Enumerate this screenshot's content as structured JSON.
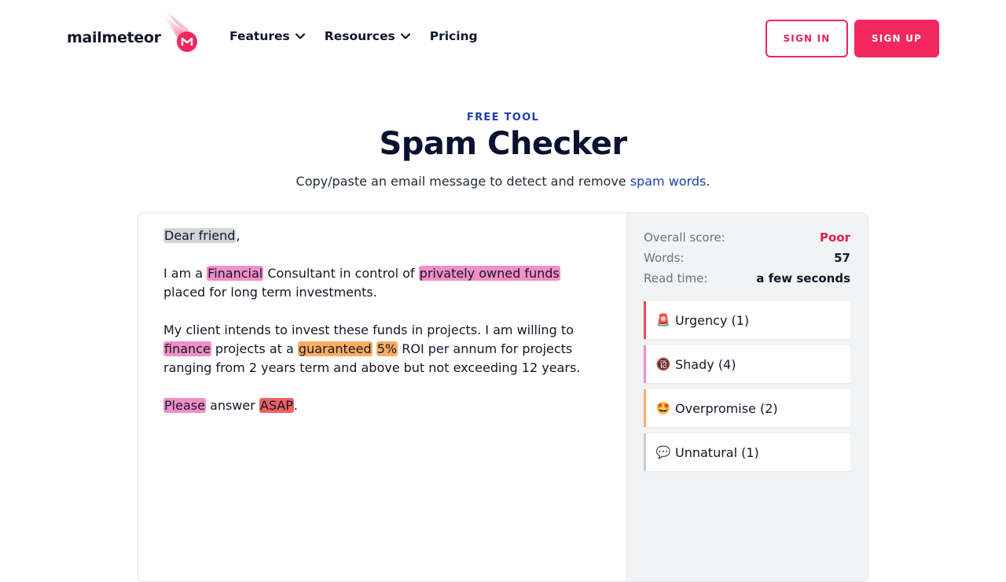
{
  "brand": {
    "name": "mailmeteor",
    "accent": "#f4265f"
  },
  "nav": {
    "items": [
      {
        "label": "Features",
        "dropdown": true
      },
      {
        "label": "Resources",
        "dropdown": true
      },
      {
        "label": "Pricing",
        "dropdown": false
      }
    ],
    "sign_in": "SIGN IN",
    "sign_up": "SIGN UP"
  },
  "hero": {
    "eyebrow": "FREE TOOL",
    "title": "Spam Checker",
    "subtitle_prefix": "Copy/paste an email message to detect and remove ",
    "subtitle_link": "spam words",
    "subtitle_suffix": "."
  },
  "editor": {
    "paragraphs": [
      [
        {
          "text": "Dear friend",
          "hl": "gray"
        },
        {
          "text": ",",
          "hl": null
        }
      ],
      [
        {
          "text": "I am a ",
          "hl": null
        },
        {
          "text": "Financial",
          "hl": "pink"
        },
        {
          "text": " Consultant in control of ",
          "hl": null
        },
        {
          "text": "privately owned funds",
          "hl": "pink"
        },
        {
          "text": " placed for long term investments.",
          "hl": null
        }
      ],
      [
        {
          "text": "My client intends to invest these funds in projects. I am willing to ",
          "hl": null
        },
        {
          "text": "finance",
          "hl": "pink"
        },
        {
          "text": " projects at a ",
          "hl": null
        },
        {
          "text": "guaranteed",
          "hl": "orange"
        },
        {
          "text": " ",
          "hl": null
        },
        {
          "text": "5%",
          "hl": "orange"
        },
        {
          "text": " ROI per annum for projects ranging from 2 years term and above but not exceeding 12 years.",
          "hl": null
        }
      ],
      [
        {
          "text": "Please",
          "hl": "pink"
        },
        {
          "text": " answer ",
          "hl": null
        },
        {
          "text": "ASAP",
          "hl": "red"
        },
        {
          "text": ".",
          "hl": null
        }
      ]
    ]
  },
  "stats": {
    "overall_label": "Overall score:",
    "overall_value": "Poor",
    "words_label": "Words:",
    "words_value": "57",
    "read_label": "Read time:",
    "read_value": "a few seconds"
  },
  "categories": [
    {
      "name": "urgency",
      "emoji": "🚨",
      "label": "Urgency (1)",
      "color": "#e0515a"
    },
    {
      "name": "shady",
      "emoji": "🔞",
      "label": "Shady (4)",
      "color": "#f28ec8"
    },
    {
      "name": "overpromise",
      "emoji": "🤩",
      "label": "Overpromise (2)",
      "color": "#fbae63"
    },
    {
      "name": "unnatural",
      "emoji": "💬",
      "label": "Unnatural (1)",
      "color": "#c9ced6"
    }
  ]
}
